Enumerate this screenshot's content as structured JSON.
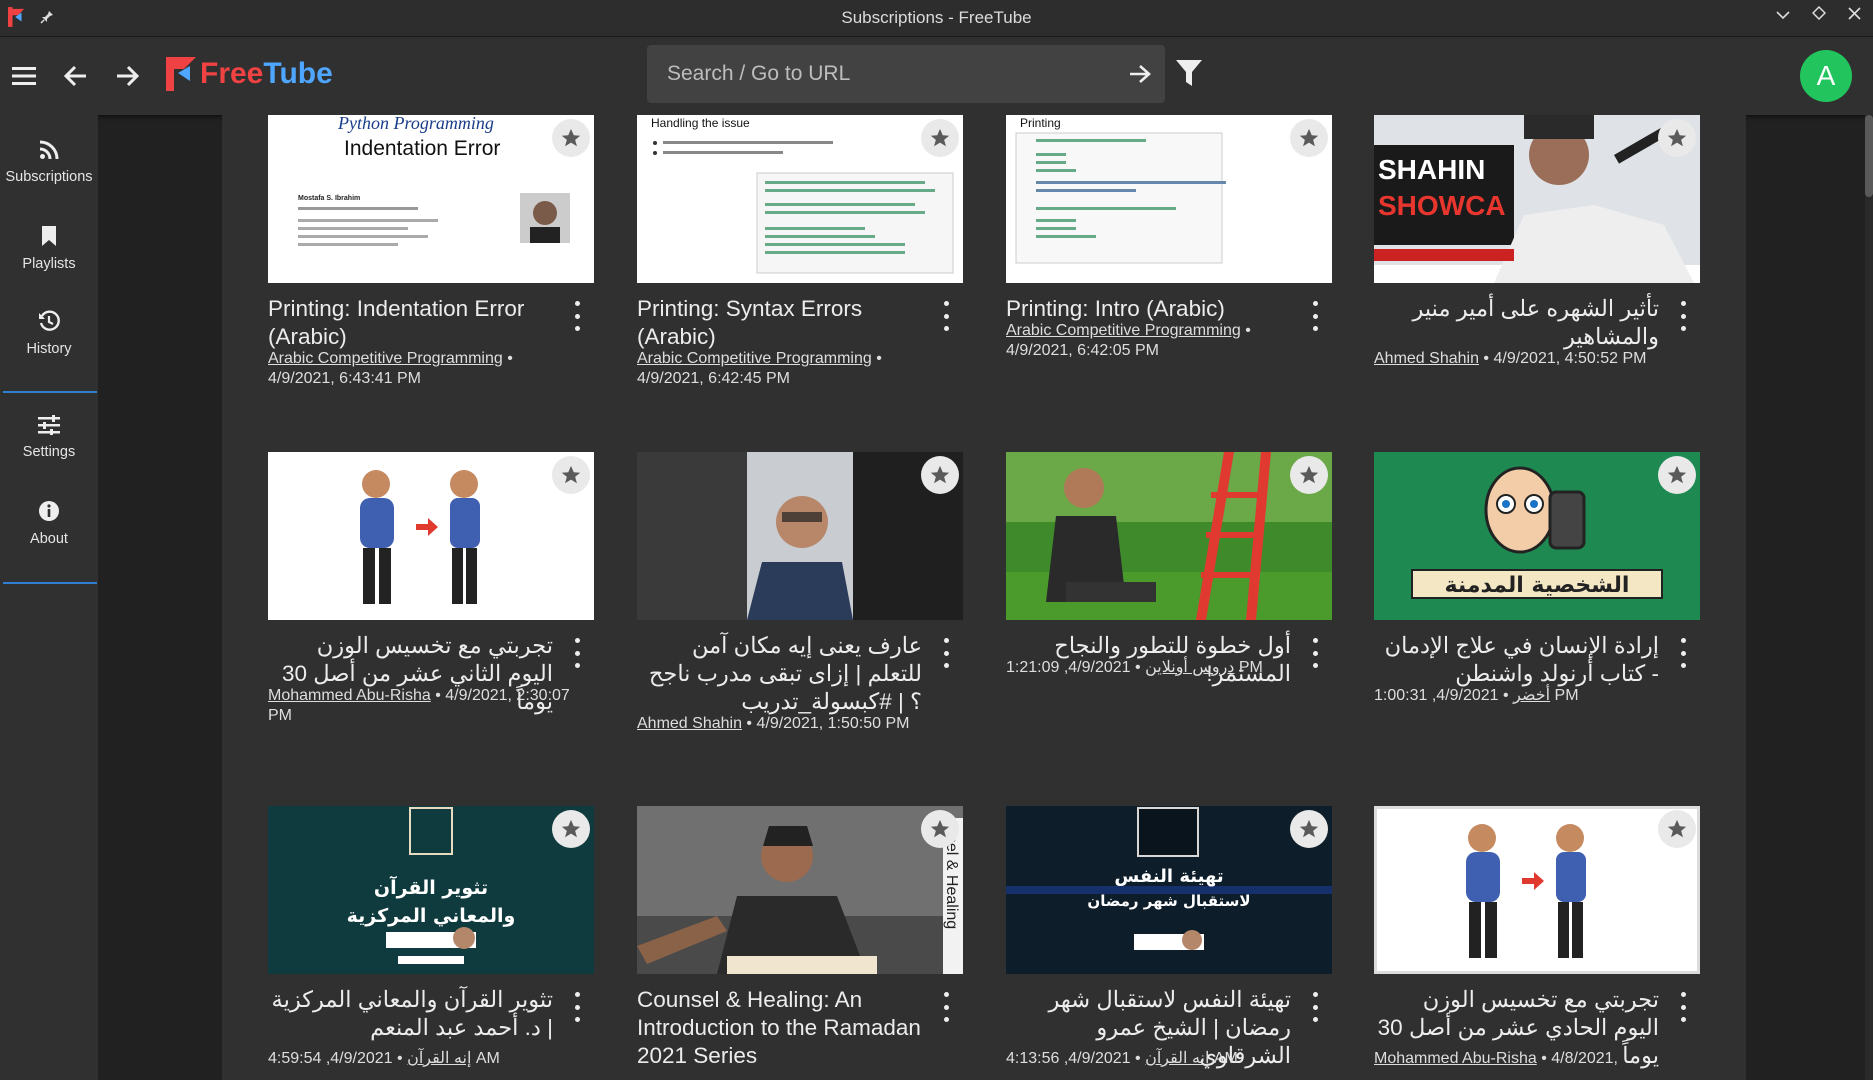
{
  "window": {
    "title": "Subscriptions - FreeTube"
  },
  "logo": {
    "free": "Free",
    "tube": "Tube"
  },
  "search": {
    "placeholder": "Search / Go to URL"
  },
  "avatar": {
    "letter": "A",
    "color": "#21c45d"
  },
  "sidebar": {
    "items": [
      {
        "label": "Subscriptions",
        "icon": "rss-icon"
      },
      {
        "label": "Playlists",
        "icon": "bookmark-icon"
      },
      {
        "label": "History",
        "icon": "history-icon"
      },
      {
        "label": "Settings",
        "icon": "sliders-icon"
      },
      {
        "label": "About",
        "icon": "info-icon"
      }
    ]
  },
  "thumb_text": {
    "v1_top": "Python Programming",
    "v1_main": "Indentation Error",
    "v1_author": "Mostafa S. Ibrahim",
    "v2_top": "Handling the issue",
    "v3_top": "Printing",
    "v4_sign": "SHAHIN",
    "v4_sign2": "SHOWCA",
    "v8_banner": "الشخصية المدمنة",
    "v9_t1": "تثوير القرآن",
    "v9_t2": "والمعاني المركزية",
    "v10_side": "nsel & Healing",
    "v11_t1": "تهيئة النفس",
    "v11_t2": "لاستقبال شهر رمضان"
  },
  "videos": [
    {
      "title": "Printing: Indentation Error (Arabic)",
      "channel": "Arabic Competitive Programming",
      "sep": " •",
      "date": "4/9/2021, 6:43:41 PM"
    },
    {
      "title": "Printing: Syntax Errors (Arabic)",
      "channel": "Arabic Competitive Programming",
      "sep": " •",
      "date": "4/9/2021, 6:42:45 PM"
    },
    {
      "title": "Printing: Intro (Arabic)",
      "channel": "Arabic Competitive Programming",
      "sep": " •",
      "date": "4/9/2021, 6:42:05 PM"
    },
    {
      "title": "تأثير الشهره على أمير منير والمشاهير",
      "channel": "Ahmed Shahin",
      "sep": " • ",
      "date": "4/9/2021, 4:50:52 PM"
    },
    {
      "title": "تجربتي مع تخسيس الوزن اليوم الثاني عشر من أصل 30 يوماً",
      "channel": "Mohammed Abu-Risha",
      "sep": " • ",
      "date": "4/9/2021, 2:30:07 PM"
    },
    {
      "title": "عارف يعنى إيه مكان آمن للتعلم | إزاى تبقى مدرب ناجح ؟ | #كبسولة_تدريب",
      "channel": "Ahmed Shahin",
      "sep": " • ",
      "date": "4/9/2021, 1:50:50 PM"
    },
    {
      "title": "أول خطوة للتطور والنجاح المستمر!",
      "channel": "دروس أونلاين",
      "sep": " • ",
      "date": "1:21:09 ,4/9/2021",
      "suffix": " PM"
    },
    {
      "title": "إرادة الإنسان في علاج الإدمان - كتاب أرنولد واشنطن",
      "channel": "أخضر",
      "sep": " • ",
      "date": "1:00:31 ,4/9/2021",
      "suffix": " PM"
    },
    {
      "title": "تثوير القرآن والمعاني المركزية | د. أحمد عبد المنعم",
      "channel": "إنه القرآن",
      "sep": " • ",
      "date": "4:59:54 ,4/9/2021",
      "suffix": " AM"
    },
    {
      "title": "Counsel & Healing: An Introduction to the Ramadan 2021 Series",
      "channel": "",
      "sep": "",
      "date": ""
    },
    {
      "title": "تهيئة النفس لاستقبال شهر رمضان | الشيخ عمرو الشرقاوي",
      "channel": "إنه القرآن",
      "sep": " • ",
      "date": "4:13:56 ,4/9/2021",
      "suffix": " AM"
    },
    {
      "title": "تجربتي مع تخسيس الوزن اليوم الحادي عشر من أصل 30 يوماً",
      "channel": "Mohammed Abu-Risha",
      "sep": " • ",
      "date": "4/8/2021,"
    }
  ],
  "colors": {
    "accent": "#2f7fd3",
    "logo_red": "#f04242",
    "logo_blue": "#4fa6ff",
    "background": "#212121",
    "panel": "#303030"
  }
}
